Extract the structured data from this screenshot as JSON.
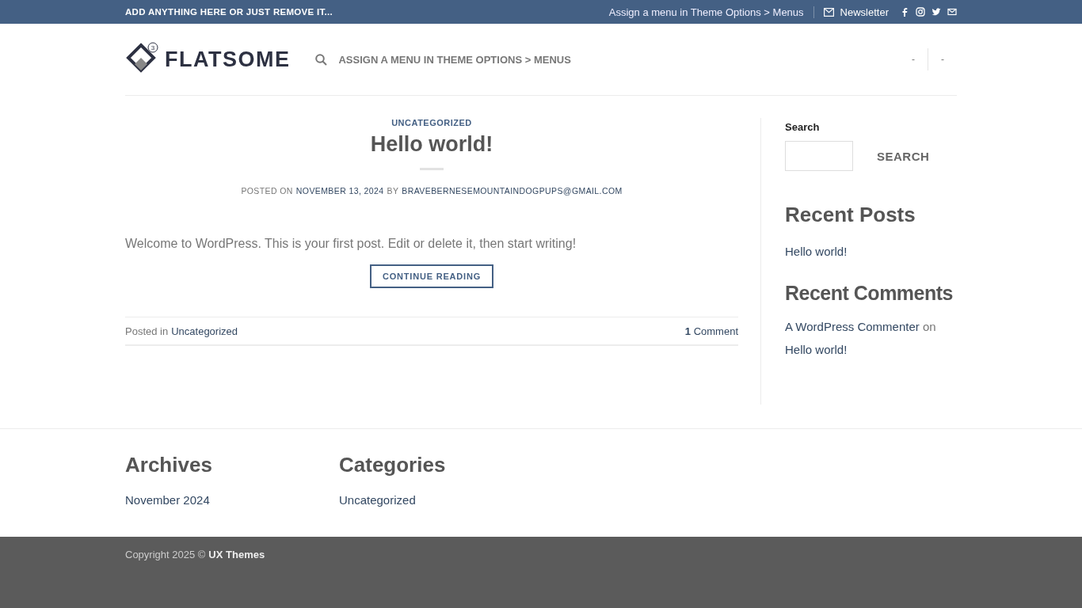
{
  "top_bar": {
    "text": "ADD ANYTHING HERE OR JUST REMOVE IT...",
    "menu_link": "Assign a menu in Theme Options > Menus",
    "newsletter": "Newsletter",
    "social": [
      {
        "kind": "facebook"
      },
      {
        "kind": "instagram"
      },
      {
        "kind": "twitter"
      },
      {
        "kind": "email"
      }
    ]
  },
  "header": {
    "logo_text": "FLATSOME",
    "logo_badge": "3",
    "nav_link": "ASSIGN A MENU IN THEME OPTIONS > MENUS",
    "right_links": [
      "-",
      "-"
    ]
  },
  "post": {
    "category": "UNCATEGORIZED",
    "title": "Hello world!",
    "meta_prefix": "POSTED ON",
    "date": "NOVEMBER 13, 2024",
    "meta_by": "BY",
    "author": "BRAVEBERNESEMOUNTAINDOGPUPS@GMAIL.COM",
    "excerpt": "Welcome to WordPress. This is your first post. Edit or delete it, then start writing!",
    "button": "CONTINUE READING",
    "posted_in": "Posted in",
    "category_link": "Uncategorized",
    "comment_count": "1",
    "comment_label": "Comment"
  },
  "sidebar": {
    "search_label": "Search",
    "search_button": "SEARCH",
    "recent_posts_title": "Recent Posts",
    "recent_posts": [
      "Hello world!"
    ],
    "recent_comments_title": "Recent Comments",
    "comment_author": "A WordPress Commenter",
    "comment_on": "on",
    "comment_post": "Hello world!"
  },
  "footer_widgets": [
    {
      "title": "Archives",
      "items": [
        "November 2024"
      ]
    },
    {
      "title": "Categories",
      "items": [
        "Uncategorized"
      ]
    }
  ],
  "copyright": {
    "text": "Copyright 2025 ©",
    "brand": "UX Themes"
  }
}
